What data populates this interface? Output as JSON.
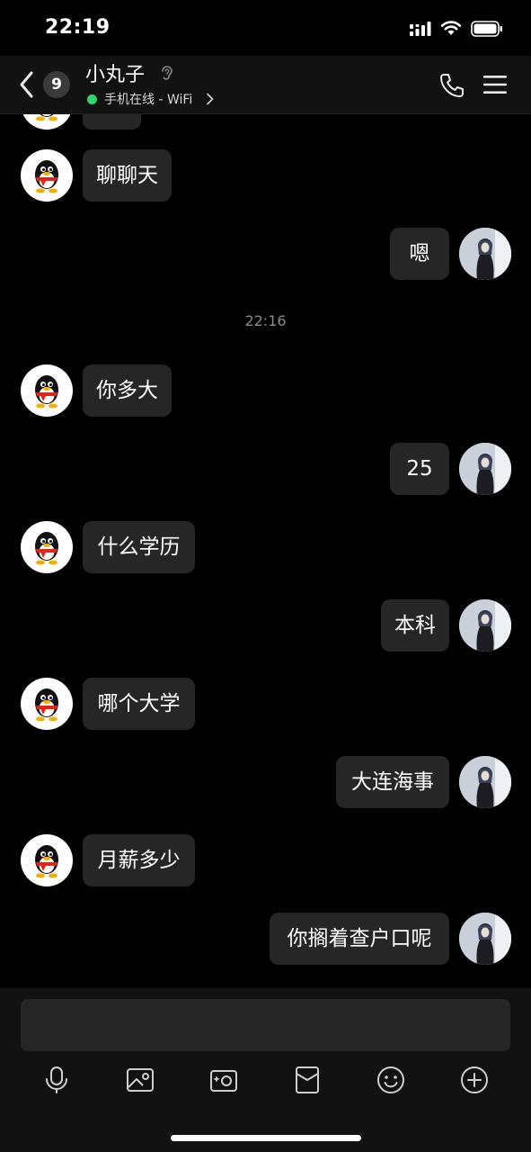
{
  "status_bar": {
    "time": "22:19"
  },
  "header": {
    "unread_count": "9",
    "contact_name": "小丸子",
    "presence": "手机在线 - WiFi"
  },
  "messages": [
    {
      "id": "m0",
      "side": "left",
      "text": ""
    },
    {
      "id": "m1",
      "side": "left",
      "text": "聊聊天"
    },
    {
      "id": "m2",
      "side": "right",
      "text": "嗯"
    },
    {
      "id": "ts",
      "type": "timestamp",
      "text": "22:16"
    },
    {
      "id": "m3",
      "side": "left",
      "text": "你多大"
    },
    {
      "id": "m4",
      "side": "right",
      "text": "25"
    },
    {
      "id": "m5",
      "side": "left",
      "text": "什么学历"
    },
    {
      "id": "m6",
      "side": "right",
      "text": "本科"
    },
    {
      "id": "m7",
      "side": "left",
      "text": "哪个大学"
    },
    {
      "id": "m8",
      "side": "right",
      "text": "大连海事"
    },
    {
      "id": "m9",
      "side": "left",
      "text": "月薪多少"
    },
    {
      "id": "m10",
      "side": "right",
      "text": "你搁着查户口呢"
    }
  ],
  "toolbar": {
    "icons": [
      "microphone-icon",
      "image-icon",
      "camera-icon",
      "red-packet-icon",
      "emoji-icon",
      "plus-icon"
    ]
  },
  "colors": {
    "background": "#000000",
    "bubble": "#262626",
    "online": "#36d36a",
    "header": "#121212"
  }
}
